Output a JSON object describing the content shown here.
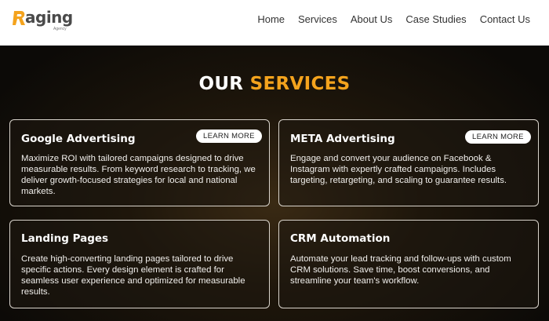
{
  "brand": {
    "logo_text": "aging",
    "logo_initial": "R",
    "logo_subtext": "Agency",
    "accent_color": "#f4a31d"
  },
  "nav": {
    "items": [
      {
        "label": "Home"
      },
      {
        "label": "Services"
      },
      {
        "label": "About Us"
      },
      {
        "label": "Case Studies"
      },
      {
        "label": "Contact Us"
      }
    ]
  },
  "services": {
    "title_part1": "OUR",
    "title_part2": "SERVICES",
    "cards": [
      {
        "title": "Google Advertising",
        "button": "LEARN MORE",
        "lines": [
          "Maximize ROI with tailored campaigns designed to drive",
          "measurable results. From keyword research to tracking, we",
          "deliver growth-focused strategies for local and national",
          "markets."
        ]
      },
      {
        "title": "META Advertising",
        "button": "LEARN MORE",
        "lines": [
          "Engage and convert your audience on Facebook &",
          "Instagram with expertly crafted campaigns. Includes",
          "targeting, retargeting, and scaling to guarantee results."
        ]
      },
      {
        "title": "Landing Pages",
        "lines": [
          "Create high-converting landing pages tailored to drive",
          "specific actions. Every design element is crafted for",
          "seamless user experience and optimized for measurable",
          "results."
        ]
      },
      {
        "title": "CRM Automation",
        "lines": [
          "Automate your lead tracking and follow-ups with custom",
          "CRM solutions. Save time, boost conversions, and",
          "streamline your team's workflow."
        ]
      }
    ]
  }
}
